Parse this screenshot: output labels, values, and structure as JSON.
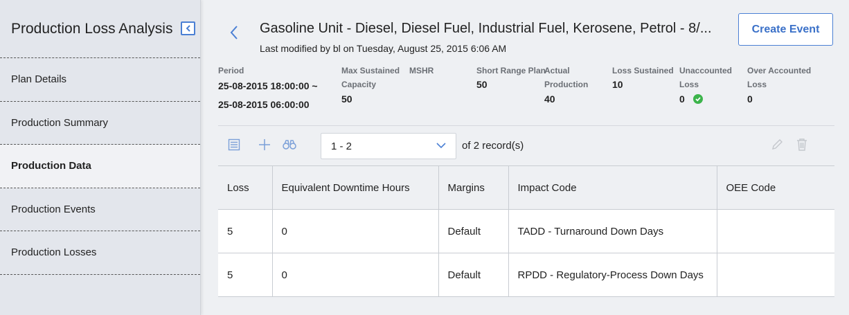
{
  "sidebar": {
    "title": "Production Loss Analysis",
    "collapse_icon": "chevron-left-icon",
    "items": [
      {
        "label": "Plan Details"
      },
      {
        "label": "Production Summary"
      },
      {
        "label": "Production Data",
        "active": true
      },
      {
        "label": "Production Events"
      },
      {
        "label": "Production Losses"
      }
    ]
  },
  "header": {
    "title": "Gasoline Unit - Diesel, Diesel Fuel, Industrial Fuel, Kerosene, Petrol - 8/...",
    "subtitle": "Last modified by bl on Tuesday, August 25, 2015 6:06 AM",
    "create_button": "Create Event"
  },
  "stats": {
    "period": {
      "label": "Period",
      "value_line1": "25-08-2015 18:00:00 ~",
      "value_line2": "25-08-2015 06:00:00"
    },
    "max_sustained": {
      "label_line1": "Max Sustained",
      "label_line2": "Capacity",
      "value": "50"
    },
    "mshr": {
      "label": "MSHR",
      "value": ""
    },
    "short_range": {
      "label": "Short Range Plan",
      "value": "50"
    },
    "actual": {
      "label_line1": "Actual",
      "label_line2": "Production",
      "value": "40"
    },
    "loss_sustained": {
      "label": "Loss Sustained",
      "value": "10"
    },
    "unaccounted": {
      "label_line1": "Unaccounted",
      "label_line2": "Loss",
      "value": "0",
      "status_icon": "check-circle-icon",
      "status_color": "#3cb44b"
    },
    "over_accounted": {
      "label_line1": "Over Accounted",
      "label_line2": "Loss",
      "value": "0"
    }
  },
  "toolbar": {
    "icons": [
      "grid-view-icon",
      "add-icon",
      "binoculars-icon",
      "edit-icon",
      "delete-icon"
    ],
    "range": "1 - 2",
    "of_label": "of",
    "record_count": "2",
    "record_suffix": "record(s)"
  },
  "table": {
    "columns": [
      "Loss",
      "Equivalent Downtime Hours",
      "Margins",
      "Impact Code",
      "OEE Code"
    ],
    "rows": [
      [
        "5",
        "0",
        "Default",
        "TADD - Turnaround Down Days",
        ""
      ],
      [
        "5",
        "0",
        "Default",
        "RPDD - Regulatory-Process Down Days",
        ""
      ]
    ]
  },
  "colors": {
    "accent": "#4a7fd4",
    "sidebar_bg": "#e3e6ec",
    "main_bg": "#eef0f3"
  }
}
